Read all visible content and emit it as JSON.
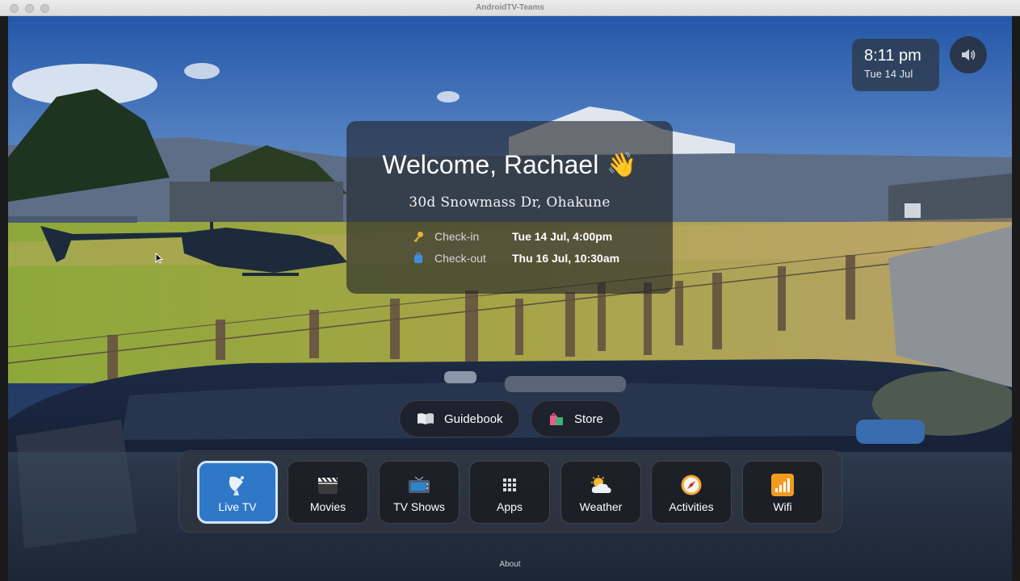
{
  "window": {
    "title": "AndroidTV-Teams"
  },
  "status": {
    "time": "8:11 pm",
    "date": "Tue 14 Jul",
    "volume_icon": "speaker-icon"
  },
  "welcome": {
    "heading": "Welcome, Rachael",
    "emoji": "👋",
    "address": "30d Snowmass Dr, Ohakune",
    "checkin_label": "Check-in",
    "checkin_value": "Tue 14 Jul, 4:00pm",
    "checkout_label": "Check-out",
    "checkout_value": "Thu 16 Jul, 10:30am"
  },
  "quick_actions": [
    {
      "label": "Guidebook",
      "icon": "book-icon"
    },
    {
      "label": "Store",
      "icon": "shopping-bag-icon"
    }
  ],
  "nav_tiles": [
    {
      "label": "Live TV",
      "icon": "satellite-dish-icon",
      "selected": true
    },
    {
      "label": "Movies",
      "icon": "clapperboard-icon",
      "selected": false
    },
    {
      "label": "TV Shows",
      "icon": "television-icon",
      "selected": false
    },
    {
      "label": "Apps",
      "icon": "grid-icon",
      "selected": false
    },
    {
      "label": "Weather",
      "icon": "sun-cloud-icon",
      "selected": false
    },
    {
      "label": "Activities",
      "icon": "compass-icon",
      "selected": false
    },
    {
      "label": "Wifi",
      "icon": "wifi-signal-icon",
      "selected": false
    }
  ],
  "footer": {
    "about_label": "About"
  },
  "colors": {
    "accent": "#2f78c8",
    "accent_border": "#cfe6ff",
    "panel": "#1e2228"
  }
}
